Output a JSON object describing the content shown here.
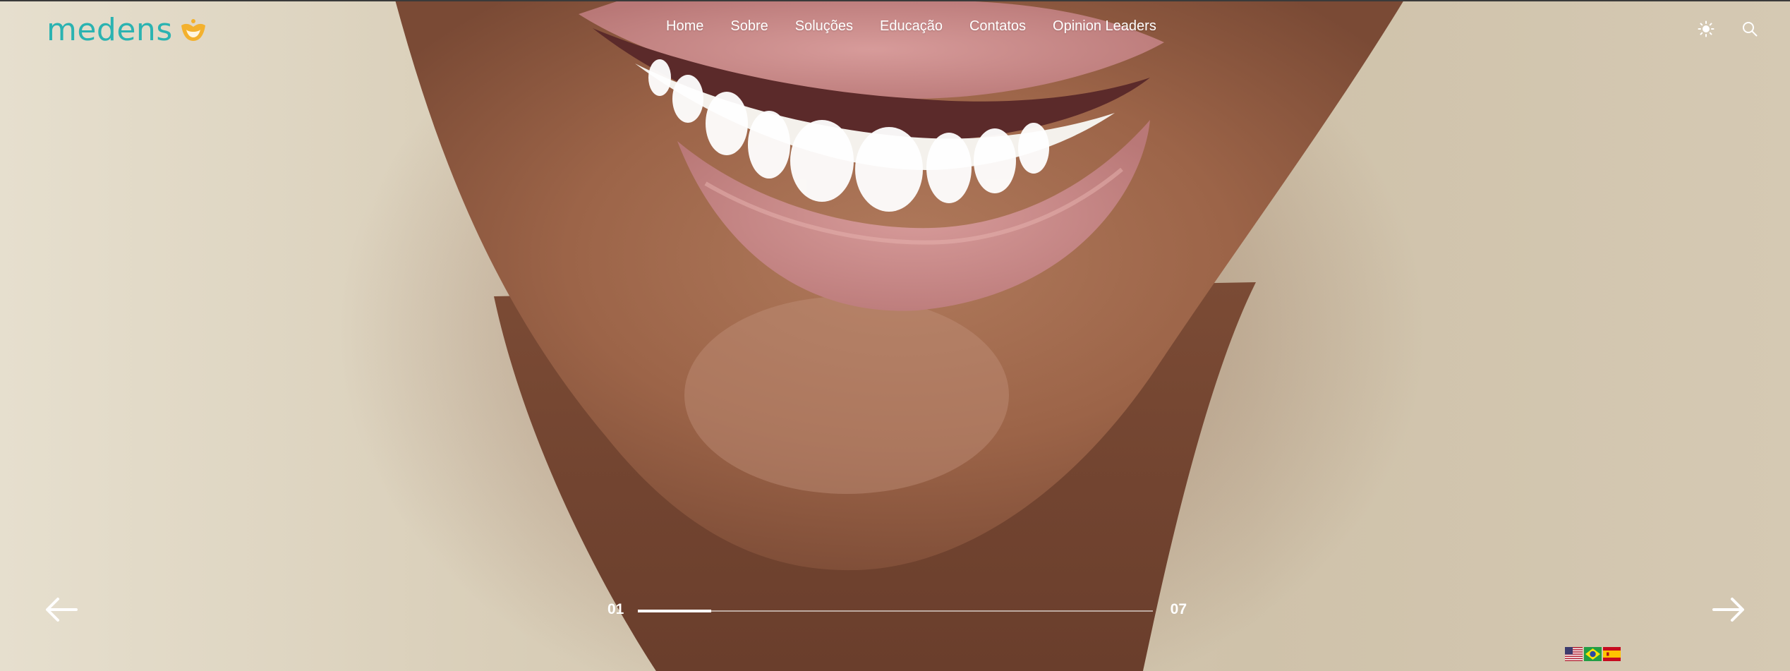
{
  "brand": {
    "name": "medens",
    "logo_color": "#2bb3b1",
    "mark_color": "#f3b12e",
    "mark_icon": "smile-mark-icon"
  },
  "nav": {
    "items": [
      {
        "label": "Home"
      },
      {
        "label": "Sobre"
      },
      {
        "label": "Soluções"
      },
      {
        "label": "Educação"
      },
      {
        "label": "Contatos"
      },
      {
        "label": "Opinion Leaders"
      }
    ]
  },
  "tools": {
    "theme_icon": "sun-icon",
    "search_icon": "search-icon"
  },
  "slider": {
    "current": "01",
    "total": "07",
    "progress_fraction": 0.143,
    "prev_icon": "arrow-left-icon",
    "next_icon": "arrow-right-icon"
  },
  "languages": [
    {
      "icon": "flag-us-icon"
    },
    {
      "icon": "flag-br-icon"
    },
    {
      "icon": "flag-es-icon"
    }
  ]
}
